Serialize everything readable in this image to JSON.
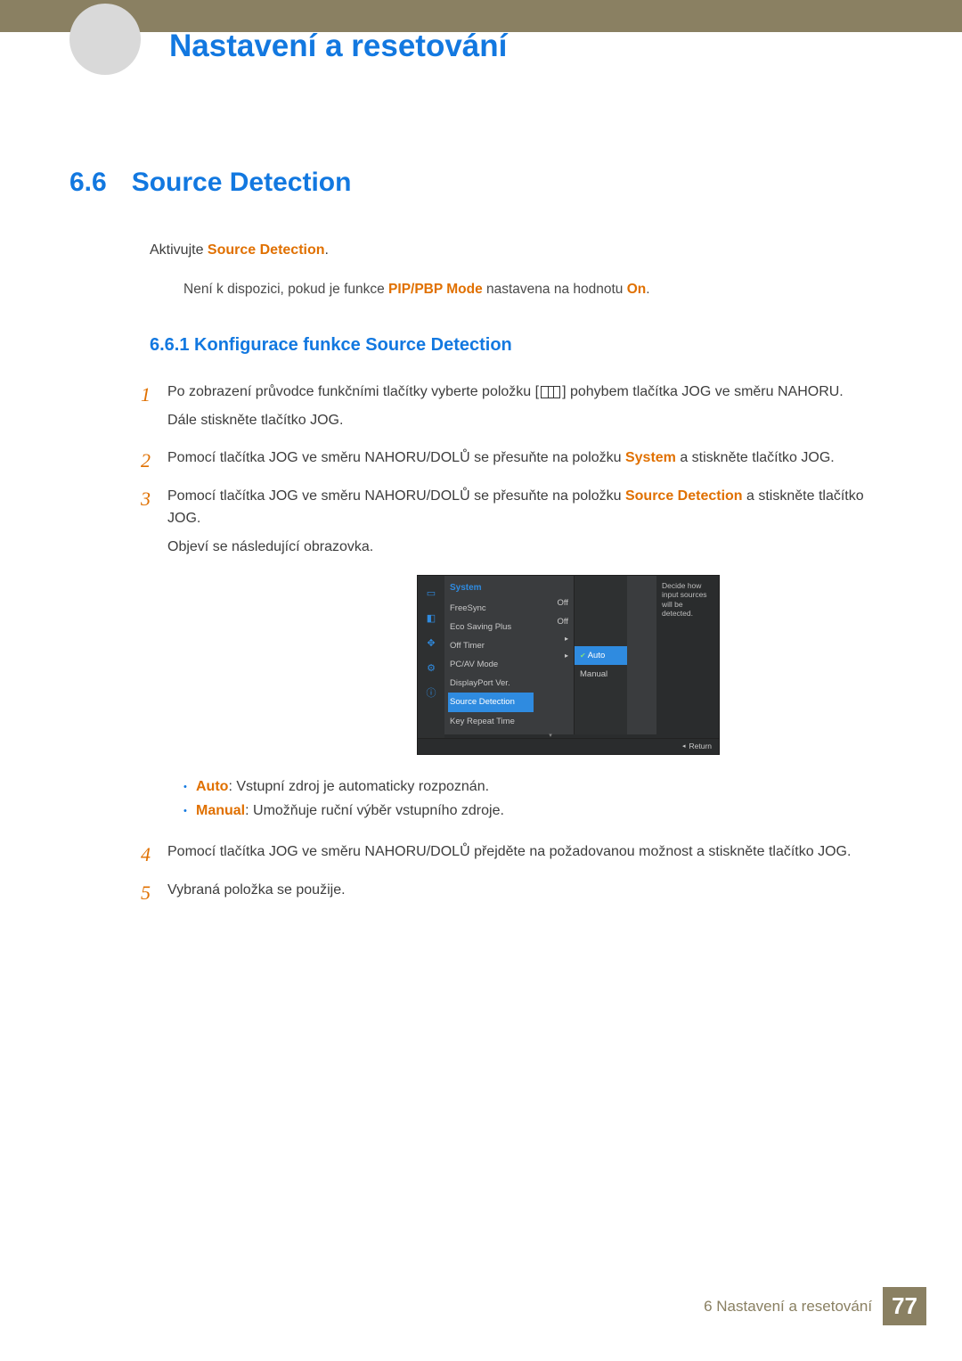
{
  "header": {
    "chapter_title": "Nastavení a resetování"
  },
  "section": {
    "number": "6.6",
    "title": "Source Detection"
  },
  "intro": {
    "prefix": "Aktivujte ",
    "hl": "Source Detection",
    "suffix": "."
  },
  "note": {
    "prefix": "Není k dispozici, pokud je funkce ",
    "hl1": "PIP/PBP Mode",
    "mid": " nastavena na hodnotu ",
    "hl2": "On",
    "suffix": "."
  },
  "subsection": "6.6.1   Konfigurace funkce Source Detection",
  "steps": {
    "1": {
      "a_pre": "Po zobrazení průvodce funkčními tlačítky vyberte položku [",
      "a_post": "] pohybem tlačítka JOG ve směru NAHORU.",
      "b": "Dále stiskněte tlačítko JOG."
    },
    "2": {
      "pre": "Pomocí tlačítka JOG ve směru NAHORU/DOLŮ se přesuňte na položku ",
      "hl": "System",
      "post": " a stiskněte tlačítko JOG."
    },
    "3": {
      "pre": "Pomocí tlačítka JOG ve směru NAHORU/DOLŮ se přesuňte na položku ",
      "hl": "Source Detection",
      "post": " a stiskněte tlačítko JOG.",
      "b": "Objeví se následující obrazovka."
    },
    "4": "Pomocí tlačítka JOG ve směru NAHORU/DOLŮ přejděte na požadovanou možnost a stiskněte tlačítko JOG.",
    "5": "Vybraná položka se použije."
  },
  "bullets": {
    "auto": {
      "hl": "Auto",
      "txt": ": Vstupní zdroj je automaticky rozpoznán."
    },
    "manual": {
      "hl": "Manual",
      "txt": ": Umožňuje ruční výběr vstupního zdroje."
    }
  },
  "osd": {
    "category": "System",
    "hint": "Decide how input sources will be detected.",
    "rows": {
      "freesync": "FreeSync",
      "eco": "Eco Saving Plus",
      "offtimer": "Off Timer",
      "pcav": "PC/AV Mode",
      "dp": "DisplayPort Ver.",
      "source": "Source Detection",
      "keyrepeat": "Key Repeat Time"
    },
    "vals": {
      "freesync": "Off",
      "eco": "Off"
    },
    "submenu": {
      "auto": "Auto",
      "manual": "Manual"
    },
    "return": "Return"
  },
  "footer": {
    "label": "6 Nastavení a resetování",
    "page": "77"
  }
}
